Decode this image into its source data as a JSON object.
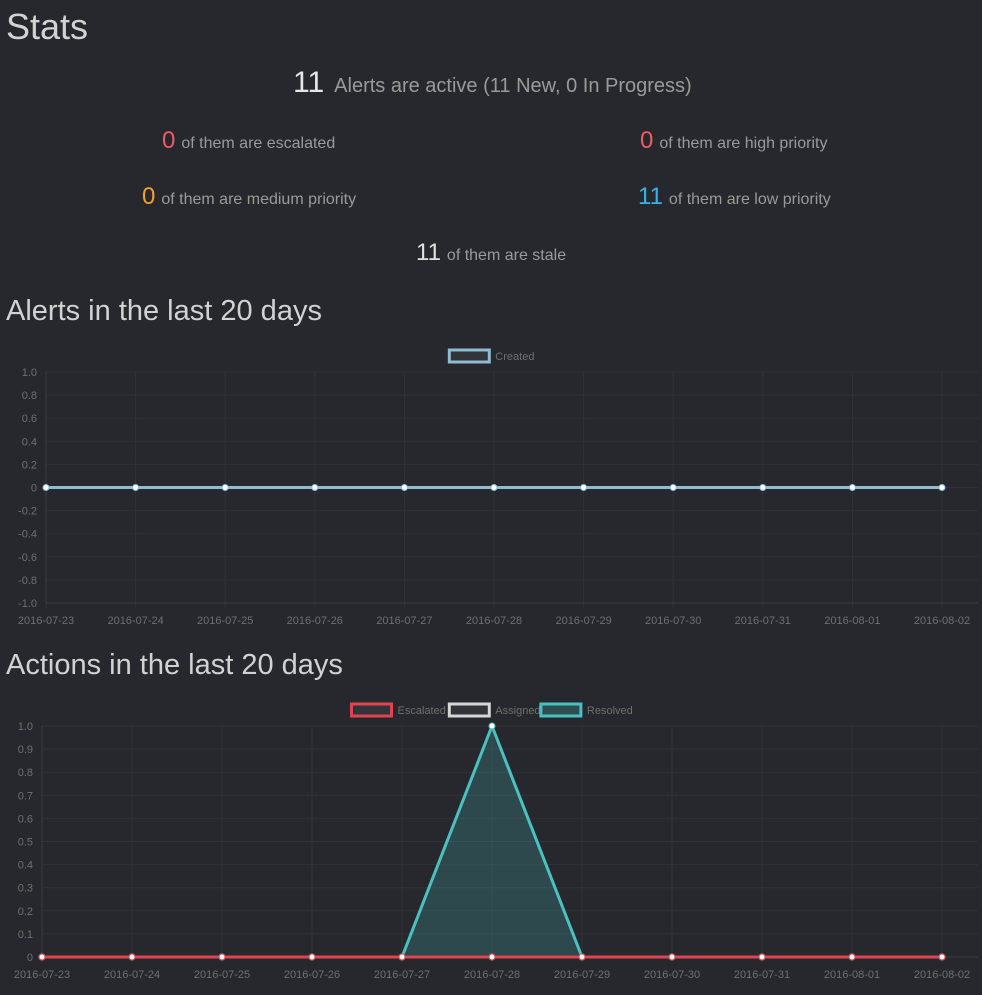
{
  "stats": {
    "title": "Stats",
    "active": {
      "count": "11",
      "text": "Alerts are active (11 New, 0 In Progress)"
    },
    "escalated": {
      "count": "0",
      "text": "of them are escalated"
    },
    "high": {
      "count": "0",
      "text": "of them are high priority"
    },
    "medium": {
      "count": "0",
      "text": "of them are medium priority"
    },
    "low": {
      "count": "11",
      "text": "of them are low priority"
    },
    "stale": {
      "count": "11",
      "text": "of them are stale"
    }
  },
  "colors": {
    "background": "#26282d",
    "grid": "#2f3237",
    "escalated": "#e0444e",
    "high": "#f05a64",
    "medium": "#f0a030",
    "low": "#36b4e6",
    "created": "#8fbcd1",
    "assigned": "#d6d6d6",
    "resolved": "#4bc0c0"
  },
  "chart_data": [
    {
      "type": "line",
      "title": "Alerts in the last 20 days",
      "x": [
        "2016-07-23",
        "2016-07-24",
        "2016-07-25",
        "2016-07-26",
        "2016-07-27",
        "2016-07-28",
        "2016-07-29",
        "2016-07-30",
        "2016-07-31",
        "2016-08-01",
        "2016-08-02"
      ],
      "yticks": [
        "1.0",
        "0.8",
        "0.6",
        "0.4",
        "0.2",
        "0",
        "-0.2",
        "-0.4",
        "-0.6",
        "-0.8",
        "-1.0"
      ],
      "ylim": [
        -1,
        1
      ],
      "grid": true,
      "legend_position": "top-center",
      "series": [
        {
          "name": "Created",
          "color": "#8fbcd1",
          "fill": false,
          "values": [
            0,
            0,
            0,
            0,
            0,
            0,
            0,
            0,
            0,
            0,
            0
          ]
        }
      ]
    },
    {
      "type": "area",
      "title": "Actions in the last 20 days",
      "x": [
        "2016-07-23",
        "2016-07-24",
        "2016-07-25",
        "2016-07-26",
        "2016-07-27",
        "2016-07-28",
        "2016-07-29",
        "2016-07-30",
        "2016-07-31",
        "2016-08-01",
        "2016-08-02"
      ],
      "yticks": [
        "1.0",
        "0.9",
        "0.8",
        "0.7",
        "0.6",
        "0.5",
        "0.4",
        "0.3",
        "0.2",
        "0.1",
        "0"
      ],
      "ylim": [
        0,
        1
      ],
      "grid": true,
      "legend_position": "top-center",
      "series": [
        {
          "name": "Escalated",
          "color": "#e0444e",
          "fill": false,
          "values": [
            0,
            0,
            0,
            0,
            0,
            0,
            0,
            0,
            0,
            0,
            0
          ]
        },
        {
          "name": "Assigned",
          "color": "#d6d6d6",
          "fill": false,
          "values": [
            0,
            0,
            0,
            0,
            0,
            0,
            0,
            0,
            0,
            0,
            0
          ]
        },
        {
          "name": "Resolved",
          "color": "#4bc0c0",
          "fill": true,
          "values": [
            0,
            0,
            0,
            0,
            0,
            1,
            0,
            0,
            0,
            0,
            0
          ]
        }
      ]
    }
  ]
}
